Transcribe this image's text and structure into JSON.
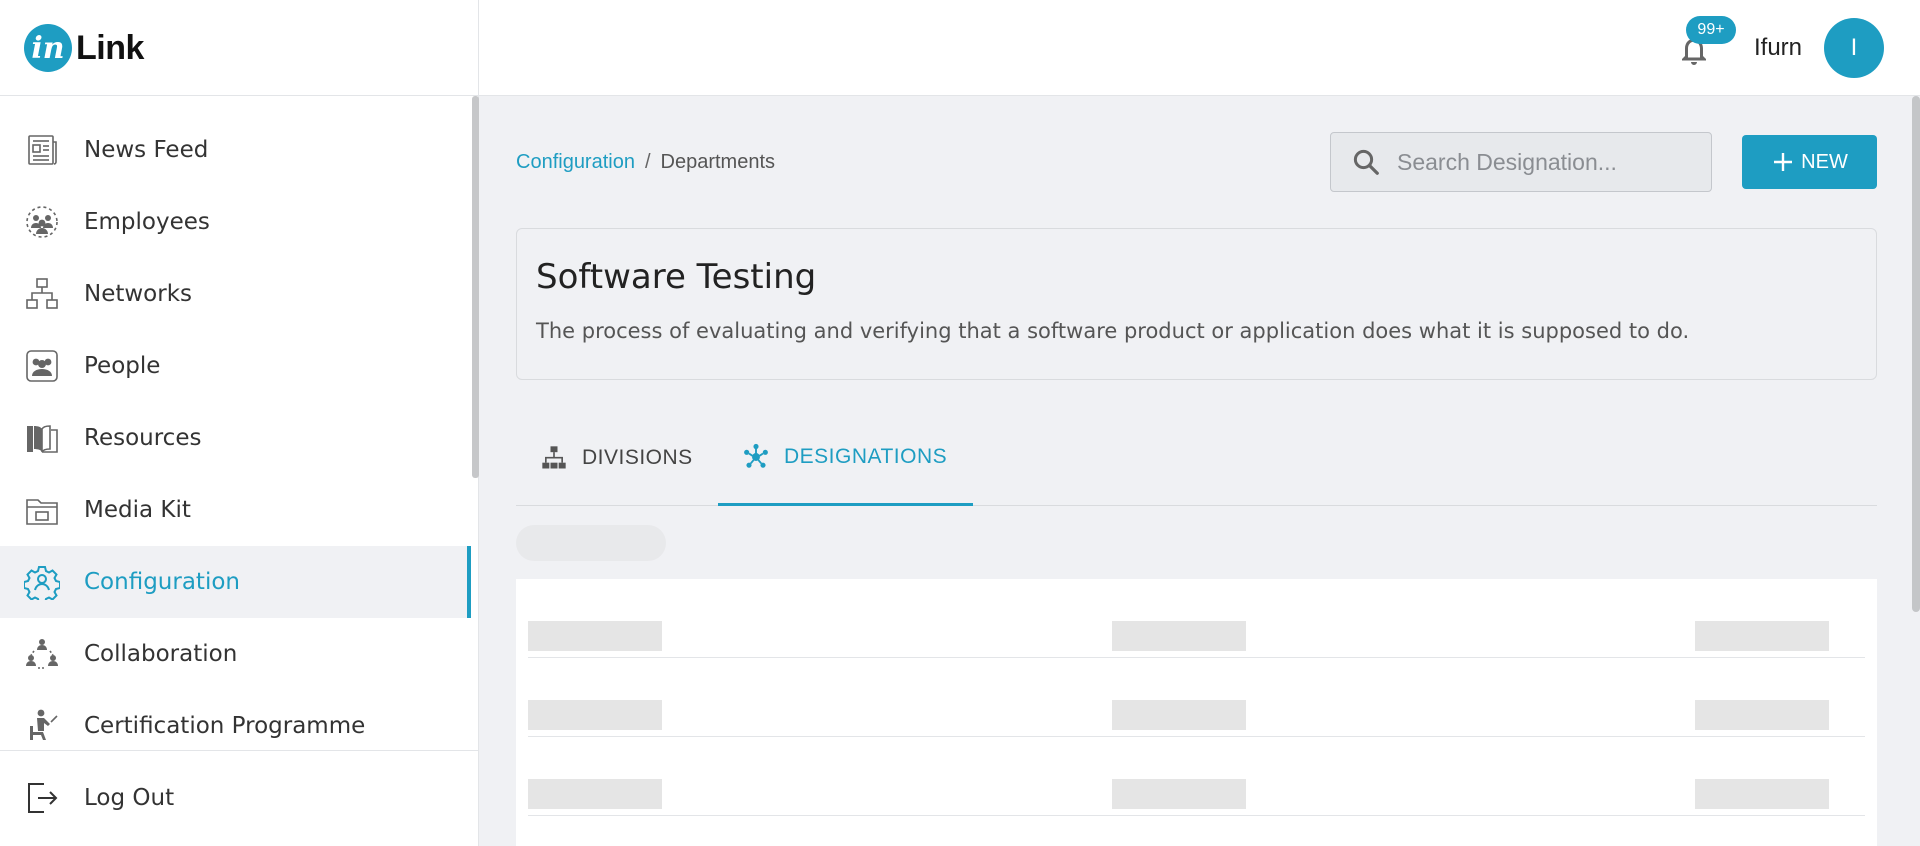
{
  "brand": {
    "logo_letter": "in",
    "name": "Link"
  },
  "header": {
    "notification_count": "99+",
    "user_name": "Ifurn",
    "user_initial": "I"
  },
  "sidebar": {
    "items": [
      {
        "label": "News Feed",
        "icon": "newspaper-icon",
        "active": false
      },
      {
        "label": "Employees",
        "icon": "employees-icon",
        "active": false
      },
      {
        "label": "Networks",
        "icon": "network-icon",
        "active": false
      },
      {
        "label": "People",
        "icon": "people-icon",
        "active": false
      },
      {
        "label": "Resources",
        "icon": "book-icon",
        "active": false
      },
      {
        "label": "Media Kit",
        "icon": "folder-icon",
        "active": false
      },
      {
        "label": "Configuration",
        "icon": "gear-icon",
        "active": true
      },
      {
        "label": "Collaboration",
        "icon": "collaboration-icon",
        "active": false
      },
      {
        "label": "Certification Programme",
        "icon": "presenter-icon",
        "active": false
      }
    ],
    "logout_label": "Log Out"
  },
  "breadcrumb": {
    "root": "Configuration",
    "separator": "/",
    "current": "Departments"
  },
  "search": {
    "placeholder": "Search Designation...",
    "value": ""
  },
  "new_button": {
    "label": "NEW"
  },
  "department": {
    "title": "Software Testing",
    "description": "The process of evaluating and verifying that a software product or application does what it is supposed to do."
  },
  "tabs": [
    {
      "label": "DIVISIONS",
      "icon": "hierarchy-icon",
      "active": false
    },
    {
      "label": "DESIGNATIONS",
      "icon": "nodes-icon",
      "active": true
    }
  ],
  "colors": {
    "accent": "#1e9dc2",
    "background": "#f0f1f4",
    "skeleton": "#e5e5e5"
  }
}
